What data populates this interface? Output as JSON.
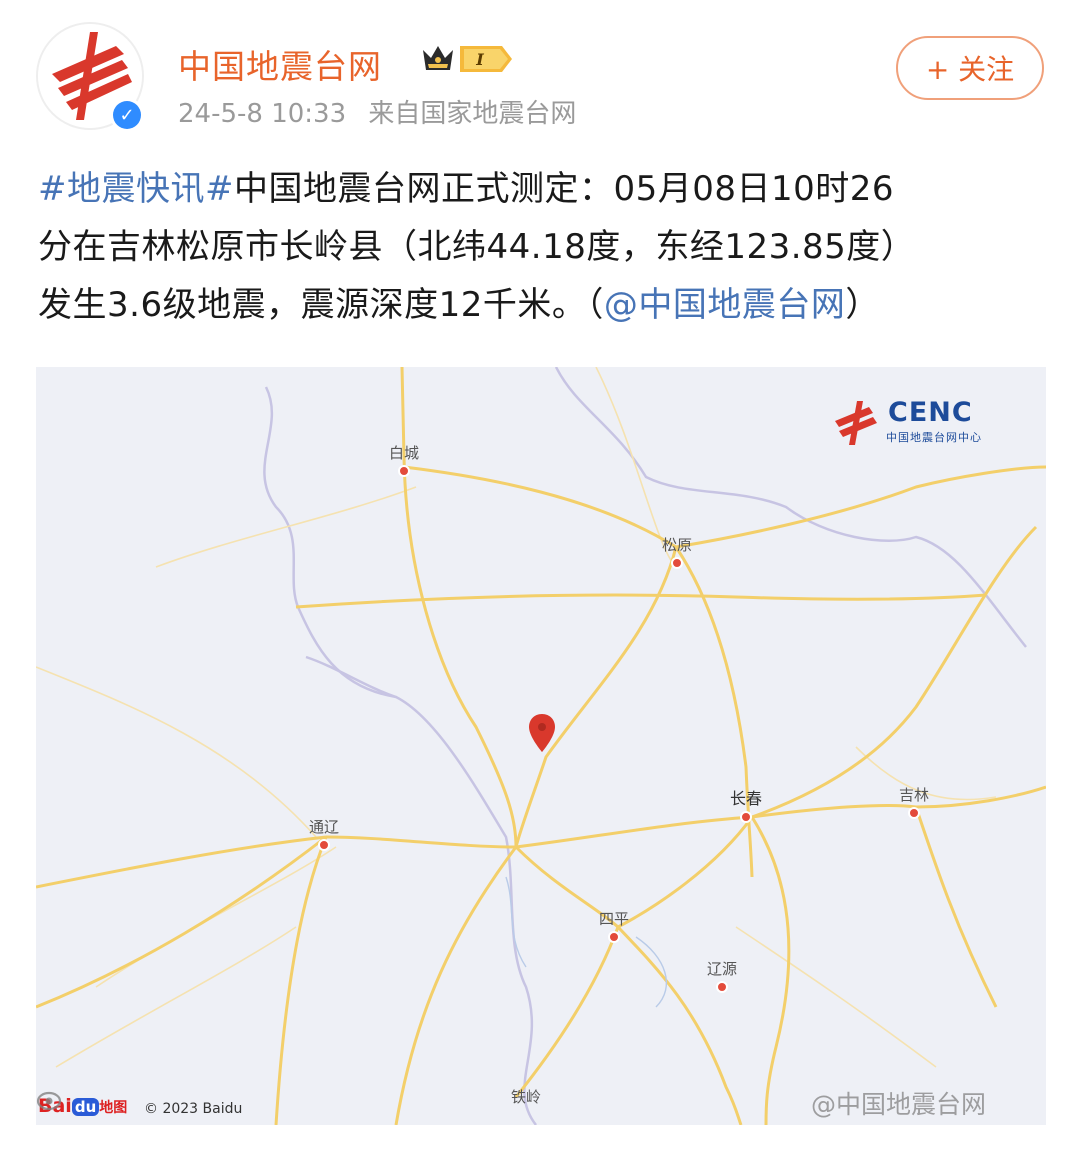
{
  "colors": {
    "brand_orange": "#e8642b",
    "link_blue": "#4774b6",
    "meta_gray": "#9a9a9a",
    "map_bg": "#eef0f6",
    "road_yellow": "#f3cf6a",
    "border_purple": "#c7c4e3",
    "epicenter_red": "#d9382c"
  },
  "header": {
    "username": "中国地震台网",
    "avatar_icon": "cenc-logo-avatar",
    "verified_icon": "verified-badge-icon",
    "verified_mark": "✓",
    "crown_icon": "crown-icon",
    "vip_label": "I",
    "timestamp": "24-5-8 10:33",
    "source": "来自国家地震台网",
    "follow_label": "+ 关注"
  },
  "post": {
    "line1_hashtag": "#地震快讯#",
    "line1_text": "中国地震台网正式测定：05月08日10时26",
    "line2_text": "分在吉林松原市长岭县（北纬44.18度，东经123.85度）",
    "line3_text": "发生3.6级地震，震源深度12千米。（",
    "line3_mention": "@中国地震台网",
    "line3_close": "）"
  },
  "map": {
    "logo_text": "CENC",
    "logo_sub": "中国地震台网中心",
    "cities": [
      {
        "name": "白城"
      },
      {
        "name": "松原"
      },
      {
        "name": "长春"
      },
      {
        "name": "吉林"
      },
      {
        "name": "通辽"
      },
      {
        "name": "四平"
      },
      {
        "name": "辽源"
      },
      {
        "name": "铁岭"
      }
    ],
    "epicenter_icon": "map-pin-icon",
    "baidu_logo": "Bai",
    "baidu_du": "du",
    "baidu_map_label": "地图",
    "copyright": "© 2023 Baidu",
    "watermark": "@中国地震台网",
    "watermark_icon": "weibo-eye-icon"
  }
}
